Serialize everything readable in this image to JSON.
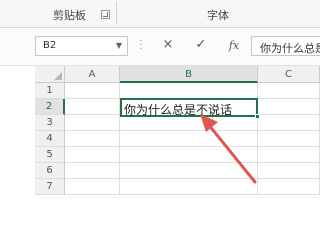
{
  "ribbon": {
    "clipboard_label": "剪贴板",
    "font_label": "字体",
    "launcher_icon": "dialog-launcher-icon"
  },
  "formula_bar": {
    "name_box": "B2",
    "cancel_icon": "×",
    "enter_icon": "✓",
    "fx_label": "fx",
    "content": "你为什么总是不说话"
  },
  "sheet": {
    "columns": [
      "A",
      "B",
      "C"
    ],
    "rows": [
      "1",
      "2",
      "3",
      "4",
      "5",
      "6",
      "7"
    ],
    "selected_cell": "B2",
    "cells": {
      "B2": "你为什么总是不说话"
    }
  },
  "annotation": {
    "arrow_color": "#e0574f",
    "selection_color": "#217346"
  }
}
